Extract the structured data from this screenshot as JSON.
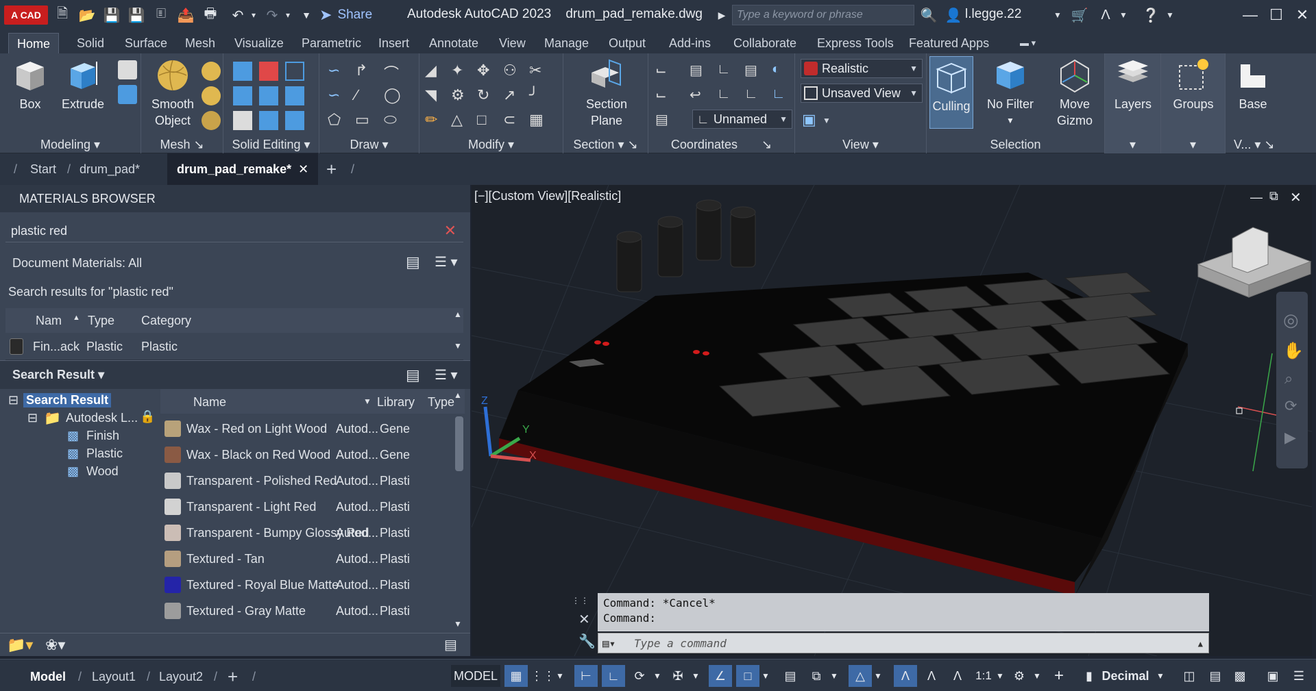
{
  "app": {
    "logo_text": "A CAD",
    "share_label": "Share",
    "title": "Autodesk AutoCAD 2023",
    "filename": "drum_pad_remake.dwg",
    "search_placeholder": "Type a keyword or phrase",
    "user": "l.legge.22"
  },
  "ribbon_tabs": [
    "Home",
    "Solid",
    "Surface",
    "Mesh",
    "Visualize",
    "Parametric",
    "Insert",
    "Annotate",
    "View",
    "Manage",
    "Output",
    "Add-ins",
    "Collaborate",
    "Express Tools",
    "Featured Apps"
  ],
  "ribbon": {
    "box": "Box",
    "extrude": "Extrude",
    "smooth_object_1": "Smooth",
    "smooth_object_2": "Object",
    "section_plane_1": "Section",
    "section_plane_2": "Plane",
    "visual_style": "Realistic",
    "view_name": "Unsaved View",
    "ucs_name": "Unnamed",
    "culling": "Culling",
    "no_filter": "No Filter",
    "move_gizmo_1": "Move",
    "move_gizmo_2": "Gizmo",
    "layers": "Layers",
    "groups": "Groups",
    "base": "Base",
    "panels": {
      "modeling": "Modeling",
      "mesh": "Mesh",
      "solid_editing": "Solid Editing",
      "draw": "Draw",
      "modify": "Modify",
      "section": "Section",
      "coordinates": "Coordinates",
      "view": "View",
      "selection": "Selection",
      "v_short": "V..."
    }
  },
  "doc_tabs": {
    "start": "Start",
    "drum_pad": "drum_pad*",
    "active": "drum_pad_remake*"
  },
  "materials": {
    "header": "MATERIALS BROWSER",
    "search_value": "plastic red",
    "doc_filter": "Document Materials: All",
    "results_caption": "Search results for \"plastic red\"",
    "doc_cols": {
      "name": "Nam",
      "type": "Type",
      "category": "Category"
    },
    "doc_row": {
      "name": "Fin...ack",
      "type": "Plastic",
      "category": "Plastic"
    },
    "search_result_label": "Search Result",
    "tree": {
      "root": "Search Result",
      "lib": "Autodesk L...",
      "children": [
        "Finish",
        "Plastic",
        "Wood"
      ]
    },
    "lib_cols": {
      "name": "Name",
      "library": "Library",
      "type": "Type"
    },
    "lib_items": [
      {
        "name": "Wax - Red on Light Wood",
        "library": "Autod...",
        "type": "Gene",
        "color": "#b8a27a"
      },
      {
        "name": "Wax - Black on Red Wood",
        "library": "Autod...",
        "type": "Gene",
        "color": "#8a5a44"
      },
      {
        "name": "Transparent - Polished Red",
        "library": "Autod...",
        "type": "Plasti",
        "color": "#c9c9c9"
      },
      {
        "name": "Transparent - Light Red",
        "library": "Autod...",
        "type": "Plasti",
        "color": "#d2d2d2"
      },
      {
        "name": "Transparent - Bumpy Glossy Red",
        "library": "Autod...",
        "type": "Plasti",
        "color": "#cbbdb5"
      },
      {
        "name": "Textured - Tan",
        "library": "Autod...",
        "type": "Plasti",
        "color": "#b59e80"
      },
      {
        "name": "Textured - Royal Blue Matte",
        "library": "Autod...",
        "type": "Plasti",
        "color": "#2424a8"
      },
      {
        "name": "Textured - Gray Matte",
        "library": "Autod...",
        "type": "Plasti",
        "color": "#9c9c9c"
      }
    ]
  },
  "viewport": {
    "label": "[−][Custom View][Realistic]",
    "axis_x": "X",
    "axis_y": "Y",
    "axis_z": "Z"
  },
  "command": {
    "line1": "Command: *Cancel*",
    "line2": "Command:",
    "placeholder": "Type a command"
  },
  "status": {
    "model_tab": "Model",
    "layout1": "Layout1",
    "layout2": "Layout2",
    "model_btn": "MODEL",
    "scale": "1:1",
    "units": "Decimal"
  }
}
